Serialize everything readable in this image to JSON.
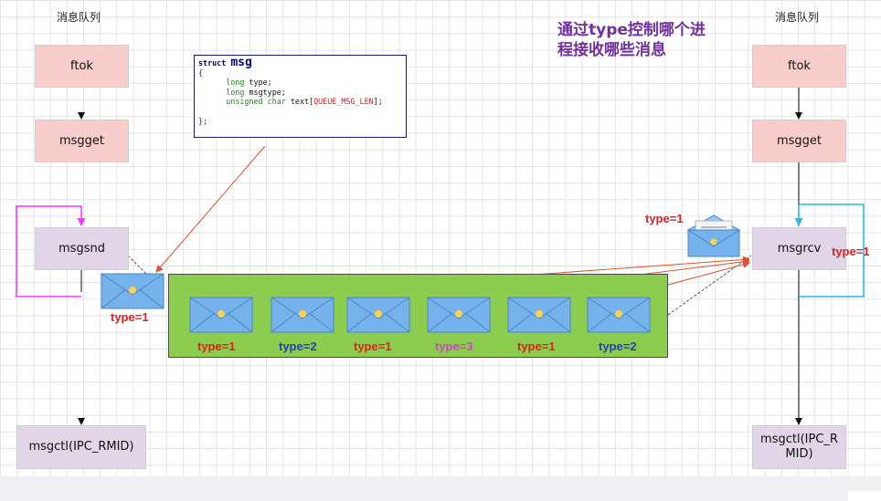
{
  "left_column": {
    "title": "消息队列",
    "steps": [
      "ftok",
      "msgget",
      "msgsnd",
      "msgctl(IPC_RMID)"
    ]
  },
  "right_column": {
    "title": "消息队列",
    "steps": [
      "ftok",
      "msgget",
      "msgrcv",
      "msgctl(IPC_R\nMID)"
    ]
  },
  "struct_code": {
    "line1_kw": "struct",
    "line1_name": "msg",
    "line2": "{",
    "line3_type": "long",
    "line3_field": "type;",
    "line4_type": "long",
    "line4_field": "msgtype;",
    "line5_type": "unsigned char",
    "line5_field": "text[",
    "line5_macro": "QUEUE_MSG_LEN",
    "line5_end": "];",
    "line6": "};"
  },
  "note": "通过type控制哪个进程接收哪些消息",
  "sender_label": "type=1",
  "receiver_labels": [
    "type=1",
    "type=1"
  ],
  "queue_messages": [
    {
      "label": "type=1",
      "color": "#e02020"
    },
    {
      "label": "type=2",
      "color": "#1f3fbf"
    },
    {
      "label": "type=1",
      "color": "#e02020"
    },
    {
      "label": "type=3",
      "color": "#cc44cc"
    },
    {
      "label": "type=1",
      "color": "#e02020"
    },
    {
      "label": "type=2",
      "color": "#1f3fbf"
    }
  ],
  "colors": {
    "pink_box": "#f8cecc",
    "lavender_box": "#e1d5e7",
    "queue_green": "#8ccd4f",
    "envelope_blue": "#76b3ec",
    "loop_magenta": "#ff33ff",
    "loop_cyan": "#29b6e6",
    "arrow_red": "#e0502a",
    "note_purple": "#7030a0"
  }
}
